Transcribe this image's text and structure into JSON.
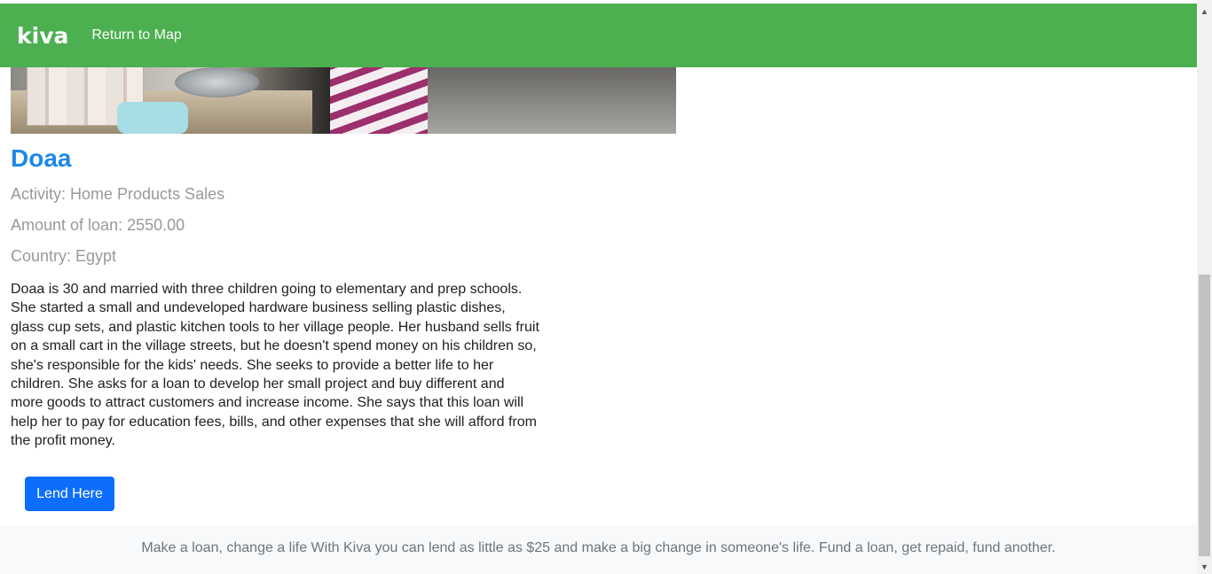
{
  "header": {
    "logo": "kiva",
    "nav_link": "Return to Map"
  },
  "loan": {
    "name": "Doaa",
    "activity": "Activity: Home Products Sales",
    "amount": "Amount of loan: 2550.00",
    "country": "Country: Egypt",
    "description": "Doaa is 30 and married with three children going to elementary and prep schools. She started a small and undeveloped hardware business selling plastic dishes, glass cup sets, and plastic kitchen tools to her village people. Her husband sells fruit on a small cart in the village streets, but he doesn't spend money on his children so, she's responsible for the kids' needs. She seeks to provide a better life to her children. She asks for a loan to develop her small project and buy different and more goods to attract customers and increase income. She says that this loan will help her to pay for education fees, bills, and other expenses that she will afford from the profit money.",
    "lend_button": "Lend Here"
  },
  "footer": {
    "text": "Make a loan, change a life With Kiva you can lend as little as $25 and make a big change in someone's life. Fund a loan, get repaid, fund another."
  },
  "colors": {
    "header_bg": "#4caf50",
    "name": "#1e88e5",
    "button_bg": "#0d6efd",
    "footer_bg": "#f8f9fa"
  }
}
